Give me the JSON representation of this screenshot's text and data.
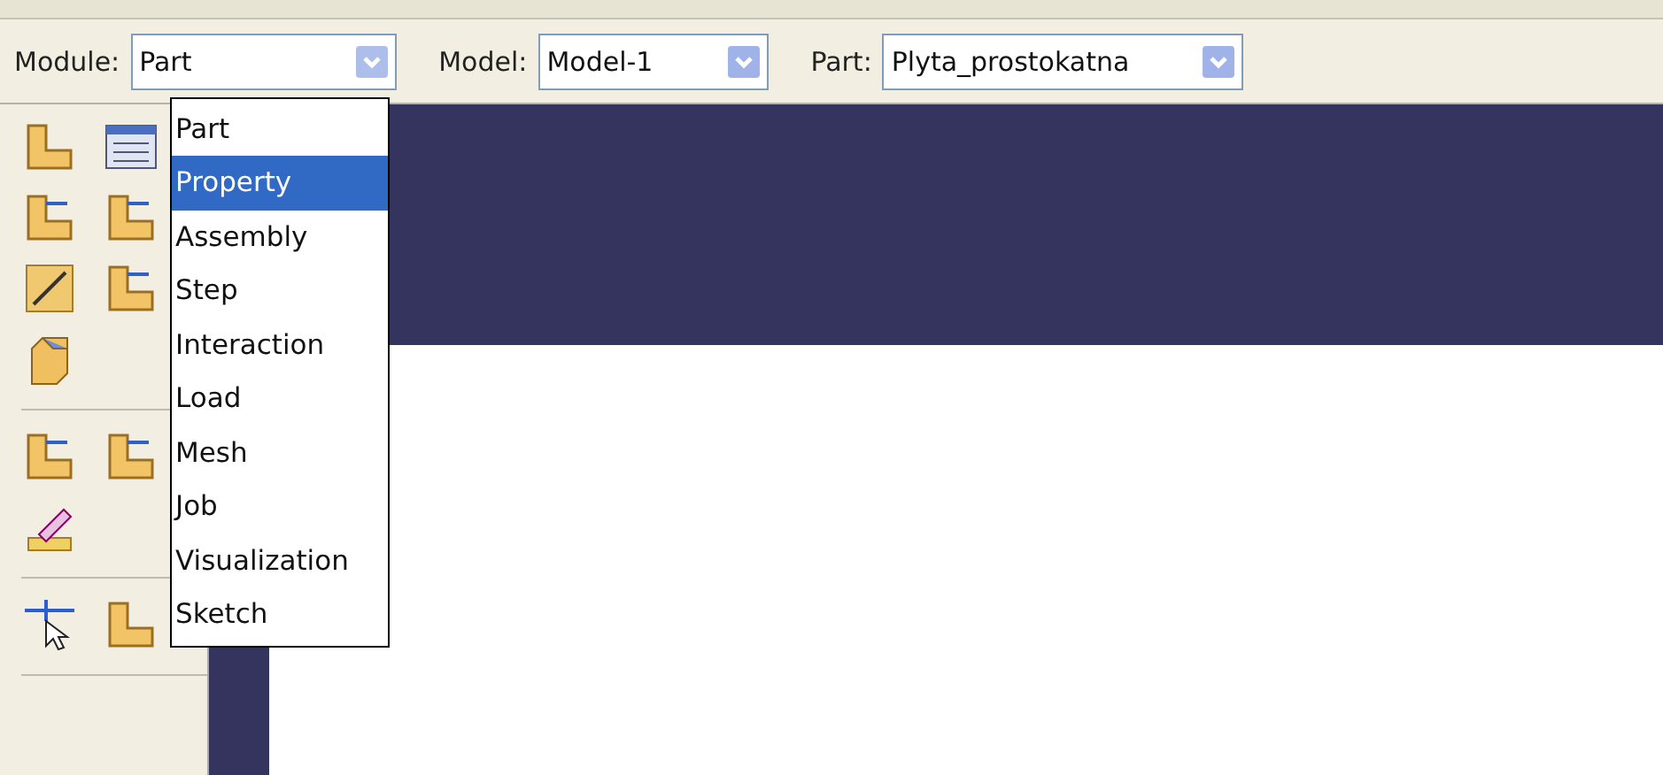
{
  "toolbar": {
    "combos": [
      {
        "label": "Module:",
        "value": "Part",
        "open": true
      },
      {
        "label": "Model:",
        "value": "Model-1",
        "open": false
      },
      {
        "label": "Part:",
        "value": "Plyta_prostokatna",
        "open": false
      }
    ]
  },
  "module_menu": {
    "items": [
      {
        "label": "Part",
        "selected": false
      },
      {
        "label": "Property",
        "selected": true
      },
      {
        "label": "Assembly",
        "selected": false
      },
      {
        "label": "Step",
        "selected": false
      },
      {
        "label": "Interaction",
        "selected": false
      },
      {
        "label": "Load",
        "selected": false
      },
      {
        "label": "Mesh",
        "selected": false
      },
      {
        "label": "Job",
        "selected": false
      },
      {
        "label": "Visualization",
        "selected": false
      },
      {
        "label": "Sketch",
        "selected": false
      }
    ]
  },
  "toolbox": {
    "groups": [
      {
        "tools": [
          {
            "kind": "solid"
          },
          {
            "kind": "table"
          },
          {
            "kind": "extrude"
          },
          {
            "kind": "shell"
          },
          {
            "kind": "line"
          },
          {
            "kind": "sweep"
          },
          {
            "kind": "chamfer"
          }
        ]
      },
      {
        "tools": [
          {
            "kind": "datum"
          },
          {
            "kind": "move"
          },
          {
            "kind": "pencil"
          }
        ]
      },
      {
        "tools": [
          {
            "kind": "query"
          },
          {
            "kind": "corner"
          }
        ]
      }
    ]
  }
}
